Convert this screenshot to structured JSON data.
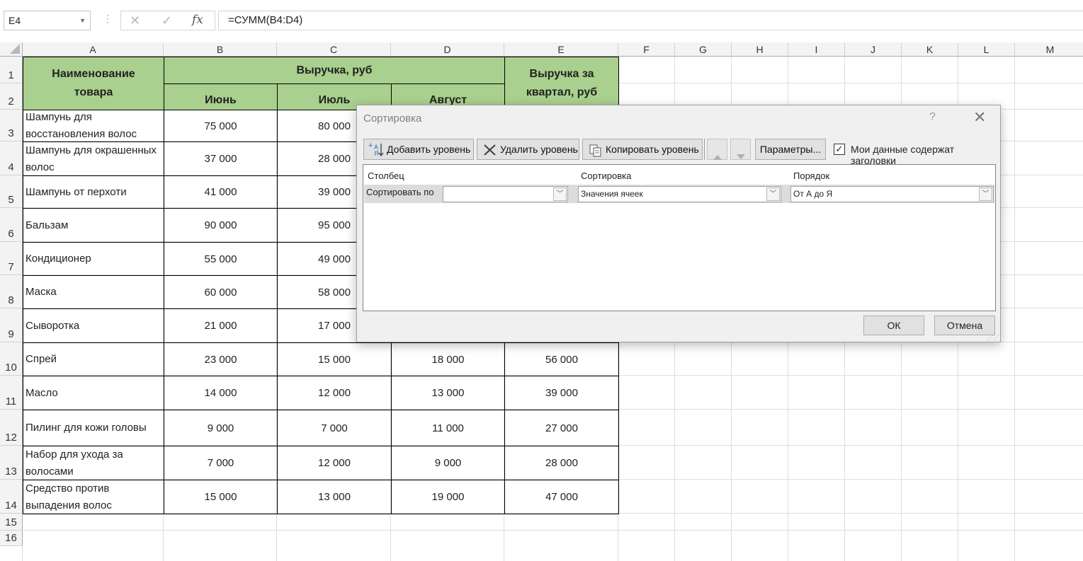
{
  "formula_bar": {
    "cell_ref": "E4",
    "cancel_icon": "✕",
    "enter_icon": "✓",
    "fx_label": "fx",
    "formula": "=СУММ(B4:D4)"
  },
  "columns": [
    "A",
    "B",
    "C",
    "D",
    "E",
    "F",
    "G",
    "H",
    "I",
    "J",
    "K",
    "L",
    "M"
  ],
  "rows": [
    "1",
    "2",
    "3",
    "4",
    "5",
    "6",
    "7",
    "8",
    "9",
    "10",
    "11",
    "12",
    "13",
    "14",
    "15",
    "16"
  ],
  "table": {
    "header_name": "Наименование товара",
    "header_revenue": "Выручка, руб",
    "header_quarter": "Выручка за квартал, руб",
    "months": [
      "Июнь",
      "Июль",
      "Август"
    ],
    "data": [
      {
        "name": "Шампунь для восстановления волос",
        "b": "75 000",
        "c": "80 000",
        "d": "",
        "e": ""
      },
      {
        "name": "Шампунь для окрашенных волос",
        "b": "37 000",
        "c": "28 000",
        "d": "",
        "e": ""
      },
      {
        "name": "Шампунь от перхоти",
        "b": "41 000",
        "c": "39 000",
        "d": "",
        "e": ""
      },
      {
        "name": "Бальзам",
        "b": "90 000",
        "c": "95 000",
        "d": "",
        "e": ""
      },
      {
        "name": "Кондиционер",
        "b": "55 000",
        "c": "49 000",
        "d": "",
        "e": ""
      },
      {
        "name": "Маска",
        "b": "60 000",
        "c": "58 000",
        "d": "",
        "e": ""
      },
      {
        "name": "Сыворотка",
        "b": "21 000",
        "c": "17 000",
        "d": "",
        "e": ""
      },
      {
        "name": "Спрей",
        "b": "23 000",
        "c": "15 000",
        "d": "18 000",
        "e": "56 000"
      },
      {
        "name": "Масло",
        "b": "14 000",
        "c": "12 000",
        "d": "13 000",
        "e": "39 000"
      },
      {
        "name": "Пилинг для кожи головы",
        "b": "9 000",
        "c": "7 000",
        "d": "11 000",
        "e": "27 000"
      },
      {
        "name": "Набор для ухода за волосами",
        "b": "7 000",
        "c": "12 000",
        "d": "9 000",
        "e": "28 000"
      },
      {
        "name": "Средство против выпадения волос",
        "b": "15 000",
        "c": "13 000",
        "d": "19 000",
        "e": "47 000"
      }
    ]
  },
  "colors": {
    "header_fill": "#a9d08e",
    "dialog_bg": "#f0f0f0"
  },
  "dialog": {
    "title": "Сортировка",
    "help": "?",
    "close": "✕",
    "add_level": "Добавить уровень",
    "delete_level": "Удалить уровень",
    "copy_level": "Копировать уровень",
    "options": "Параметры...",
    "has_headers_label": "Мои данные содержат заголовки",
    "has_headers_checked": true,
    "col_header_column": "Столбец",
    "col_header_sort_on": "Сортировка",
    "col_header_order": "Порядок",
    "sort_by_label": "Сортировать по",
    "column_value": "",
    "sort_on_value": "Значения ячеек",
    "order_value": "От А до Я",
    "ok": "ОК",
    "cancel": "Отмена"
  }
}
